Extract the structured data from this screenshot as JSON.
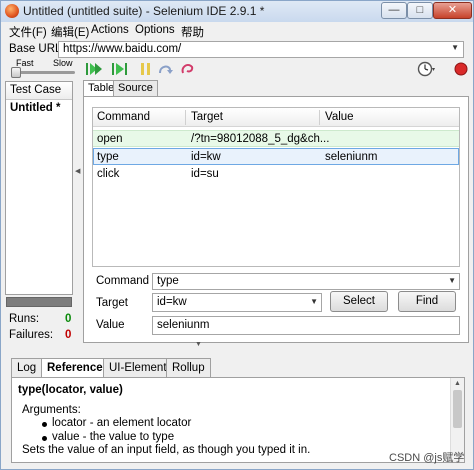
{
  "window": {
    "title": "Untitled (untitled suite) - Selenium IDE 2.9.1 *",
    "minimize_glyph": "—",
    "maximize_glyph": "□",
    "close_glyph": "✕"
  },
  "menu": {
    "file": "文件(F)",
    "edit": "编辑(E)",
    "actions": "Actions",
    "options": "Options",
    "help": "帮助"
  },
  "base_url": {
    "label": "Base URL",
    "value": "https://www.baidu.com/",
    "dropdown_glyph": "▼"
  },
  "speed": {
    "fast_label": "Fast",
    "slow_label": "Slow",
    "level_fraction": 0.0
  },
  "toolbar_icons": [
    "play-all-icon",
    "play-current-icon",
    "pause-icon",
    "step-icon",
    "rollup-icon",
    "timer-icon",
    "record-icon"
  ],
  "test_case_panel": {
    "header": "Test Case",
    "items": [
      "Untitled *"
    ]
  },
  "stats": {
    "runs_label": "Runs:",
    "runs_value": "0",
    "failures_label": "Failures:",
    "failures_value": "0"
  },
  "editor_tabs": [
    "Table",
    "Source"
  ],
  "table": {
    "columns": [
      "Command",
      "Target",
      "Value"
    ],
    "rows": [
      {
        "command": "open",
        "target": "/?tn=98012088_5_dg&ch...",
        "value": ""
      },
      {
        "command": "type",
        "target": "id=kw",
        "value": "seleniunm"
      },
      {
        "command": "click",
        "target": "id=su",
        "value": ""
      }
    ]
  },
  "command_form": {
    "command_label": "Command",
    "command_value": "type",
    "target_label": "Target",
    "target_value": "id=kw",
    "value_label": "Value",
    "value_value": "seleniunm",
    "select_button": "Select",
    "find_button": "Find"
  },
  "bottom_tabs": [
    "Log",
    "Reference",
    "UI-Element",
    "Rollup"
  ],
  "reference": {
    "signature": "type(locator, value)",
    "arguments_label": "Arguments:",
    "arguments": [
      "locator - an element locator",
      "value - the value to type"
    ],
    "description": "Sets the value of an input field, as though you typed it in."
  },
  "watermark": "CSDN @js赋学",
  "colors": {
    "open_row_bg": "#e8f9e8",
    "selected_row_border": "#6ea8e4",
    "runs_green": "#0a8a0a",
    "failures_red": "#c00000"
  }
}
